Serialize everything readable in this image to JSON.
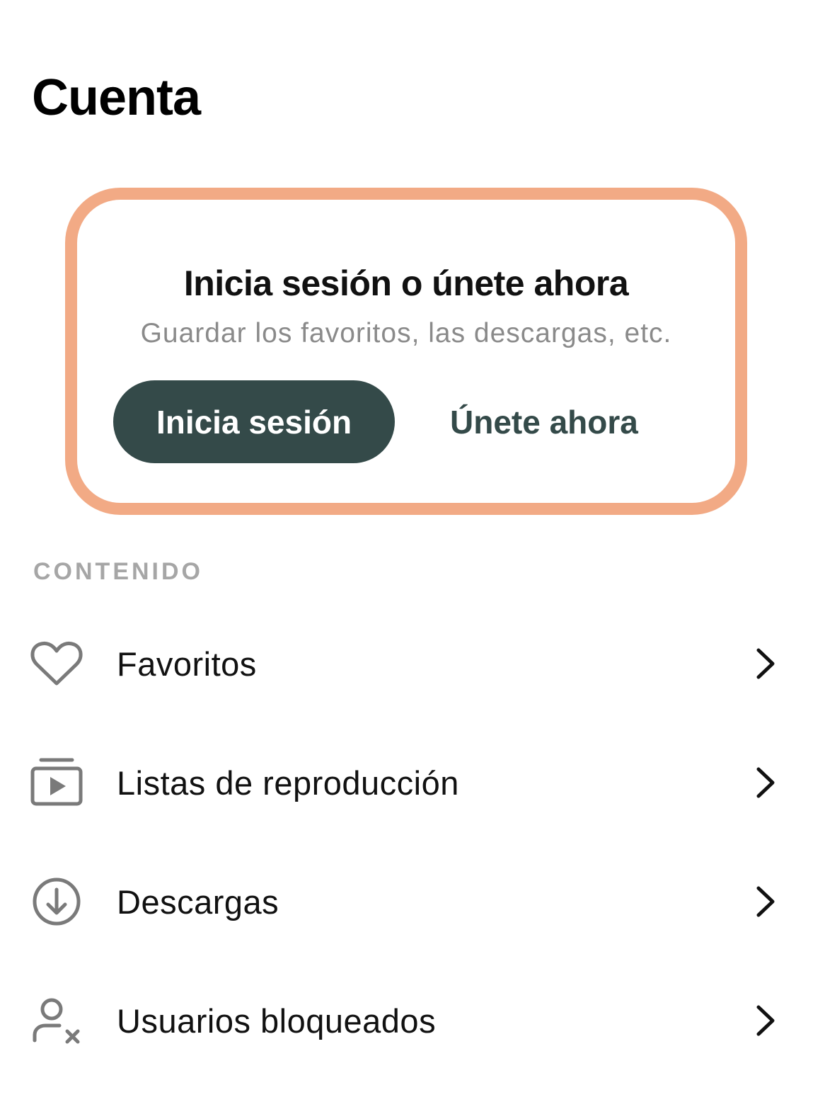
{
  "header": {
    "title": "Cuenta"
  },
  "promo": {
    "title": "Inicia sesión o únete ahora",
    "subtitle": "Guardar los favoritos, las descargas, etc.",
    "signin_label": "Inicia sesión",
    "join_label": "Únete ahora",
    "border_color": "#f2aa85",
    "button_color": "#344a49"
  },
  "content_section": {
    "label": "CONTENIDO",
    "items": [
      {
        "label": "Favoritos",
        "icon": "heart-icon"
      },
      {
        "label": "Listas de reproducción",
        "icon": "playlist-icon"
      },
      {
        "label": "Descargas",
        "icon": "download-icon"
      },
      {
        "label": "Usuarios bloqueados",
        "icon": "blocked-user-icon"
      }
    ],
    "chevron_icon": "chevron-right-icon"
  }
}
